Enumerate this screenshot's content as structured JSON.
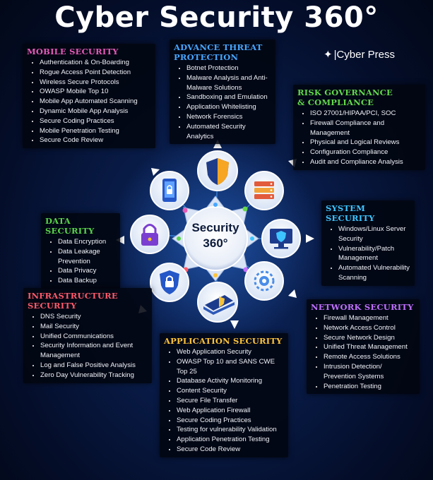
{
  "title": "Cyber Security 360°",
  "brand": {
    "mark": "✦",
    "text": "|Cyber Press"
  },
  "center": {
    "line1": "Security",
    "line2": "360°"
  },
  "sections": {
    "mobile": {
      "heading": "MOBILE SECURITY",
      "color": "#e65ab8",
      "items": [
        "Authentication & On-Boarding",
        "Rogue Access Point Detection",
        "Wireless Secure Protocols",
        "OWASP Mobile Top 10",
        "Mobile App Automated Scanning",
        "Dynamic Mobile App Analysis",
        "Secure Coding Practices",
        "Mobile Penetration Testing",
        "Secure Code Review"
      ]
    },
    "advance": {
      "heading_line1": "ADVANCE THREAT",
      "heading_line2": "PROTECTION",
      "color": "#47a6ff",
      "items": [
        "Botnet Protection",
        "Malware Analysis and Anti-Malware Solutions",
        "Sandboxing and Emulation",
        "Application Whitelisting",
        "Network Forensics",
        "Automated Security Analytics"
      ]
    },
    "risk": {
      "heading_line1": "RISK GOVERNANCE",
      "heading_line2": "& COMPLIANCE",
      "color": "#62d84a",
      "items": [
        "ISO 27001/HIPAA/PCI, SOC",
        "Firewall Compliance and Management",
        "Physical and Logical Reviews",
        "Configuration Compliance",
        "Audit and Compliance Analysis"
      ]
    },
    "system": {
      "heading": "SYSTEM SECURITY",
      "color": "#3ec4ff",
      "items": [
        "Windows/Linux Server Security",
        "Vulnerability/Patch Management",
        "Automated Vulnerability Scanning"
      ]
    },
    "data": {
      "heading": "DATA SECURITY",
      "color": "#59d44a",
      "items": [
        "Data Encryption",
        "Data Leakage Prevention",
        "Data Privacy",
        "Data Backup"
      ]
    },
    "infra": {
      "heading_line1": "INFRASTRUCTURE",
      "heading_line2": "SECURITY",
      "color": "#ff5a6a",
      "items": [
        "DNS Security",
        "Mail Security",
        "Unified Communications",
        "Security Information and Event Management",
        "Log and False Positive Analysis",
        "Zero Day Vulnerability Tracking"
      ]
    },
    "network": {
      "heading": "NETWORK SECURITY",
      "color": "#c070ff",
      "items": [
        "Firewall Management",
        "Network Access Control",
        "Secure Network Design",
        "Unified Threat Management",
        "Remote Access Solutions",
        "Intrusion Detection/ Prevention Systems",
        "Penetration Testing"
      ]
    },
    "appsec": {
      "heading": "APPLICATION SECURITY",
      "color": "#ffc43a",
      "items": [
        "Web Application Security",
        "OWASP Top 10 and SANS CWE Top 25",
        "Database Activity Monitoring",
        "Content Security",
        "Secure File Transfer",
        "Web Application Firewall",
        "Secure Coding Practices",
        "Testing for vulnerability Validation",
        "Application Penetration Testing",
        "Secure Code Review"
      ]
    }
  },
  "icons": [
    "shield-icon",
    "server-stack-icon",
    "monitor-shield-icon",
    "chip-gear-icon",
    "laptop-shield-icon",
    "lock-shield-icon",
    "padlock-icon",
    "mobile-lock-icon"
  ],
  "colors": {
    "background": "#081a45",
    "hub_ring": "#2a6fd6",
    "arrow": "#ffffff"
  }
}
